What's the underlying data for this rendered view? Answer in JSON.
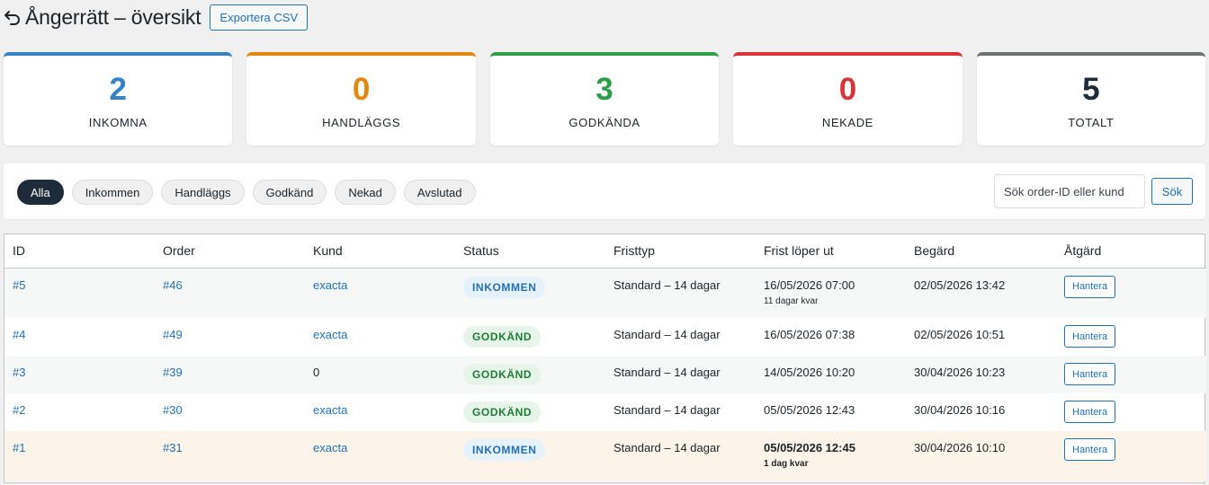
{
  "header": {
    "title": "Ångerrätt – översikt",
    "export_label": "Exportera CSV"
  },
  "cards": [
    {
      "value": "2",
      "label": "INKOMNA",
      "color": "#3582c4"
    },
    {
      "value": "0",
      "label": "HANDLÄGGS",
      "color": "#e0890e"
    },
    {
      "value": "3",
      "label": "GODKÄNDA",
      "color": "#2e9e48"
    },
    {
      "value": "0",
      "label": "NEKADE",
      "color": "#d63638"
    },
    {
      "value": "5",
      "label": "TOTALT",
      "color": "#6b7370"
    }
  ],
  "filters": {
    "pills": [
      "Alla",
      "Inkommen",
      "Handläggs",
      "Godkänd",
      "Nekad",
      "Avslutad"
    ],
    "active": "Alla",
    "search_placeholder": "Sök order-ID eller kund",
    "search_button": "Sök"
  },
  "table": {
    "columns": [
      "ID",
      "Order",
      "Kund",
      "Status",
      "Fristtyp",
      "Frist löper ut",
      "Begärd",
      "Åtgärd"
    ],
    "rows": [
      {
        "id": "#5",
        "order": "#46",
        "customer": "exacta",
        "status": "INKOMMEN",
        "deadline_type": "Standard – 14 dagar",
        "expires": "16/05/2026 07:00",
        "expires_note": "11 dagar kvar",
        "requested": "02/05/2026 13:42",
        "action": "Hantera"
      },
      {
        "id": "#4",
        "order": "#49",
        "customer": "exacta",
        "status": "GODKÄND",
        "deadline_type": "Standard – 14 dagar",
        "expires": "16/05/2026 07:38",
        "requested": "02/05/2026 10:51",
        "action": "Hantera"
      },
      {
        "id": "#3",
        "order": "#39",
        "customer": "0",
        "status": "GODKÄND",
        "deadline_type": "Standard – 14 dagar",
        "expires": "14/05/2026 10:20",
        "requested": "30/04/2026 10:23",
        "action": "Hantera"
      },
      {
        "id": "#2",
        "order": "#30",
        "customer": "exacta",
        "status": "GODKÄND",
        "deadline_type": "Standard – 14 dagar",
        "expires": "05/05/2026 12:43",
        "requested": "30/04/2026 10:16",
        "action": "Hantera"
      },
      {
        "id": "#1",
        "order": "#31",
        "customer": "exacta",
        "status": "INKOMMEN",
        "deadline_type": "Standard – 14 dagar",
        "expires": "05/05/2026 12:45",
        "expires_note": "1 dag kvar",
        "requested": "30/04/2026 10:10",
        "action": "Hantera"
      }
    ]
  },
  "colors": {
    "accent": "#2271b1",
    "active_pill": "#1d2b3a",
    "inkommen_badge_bg": "#e5f1fb",
    "godkand_badge_bg": "#e6f4ea",
    "urgent_row_bg": "#fcf4e9"
  }
}
